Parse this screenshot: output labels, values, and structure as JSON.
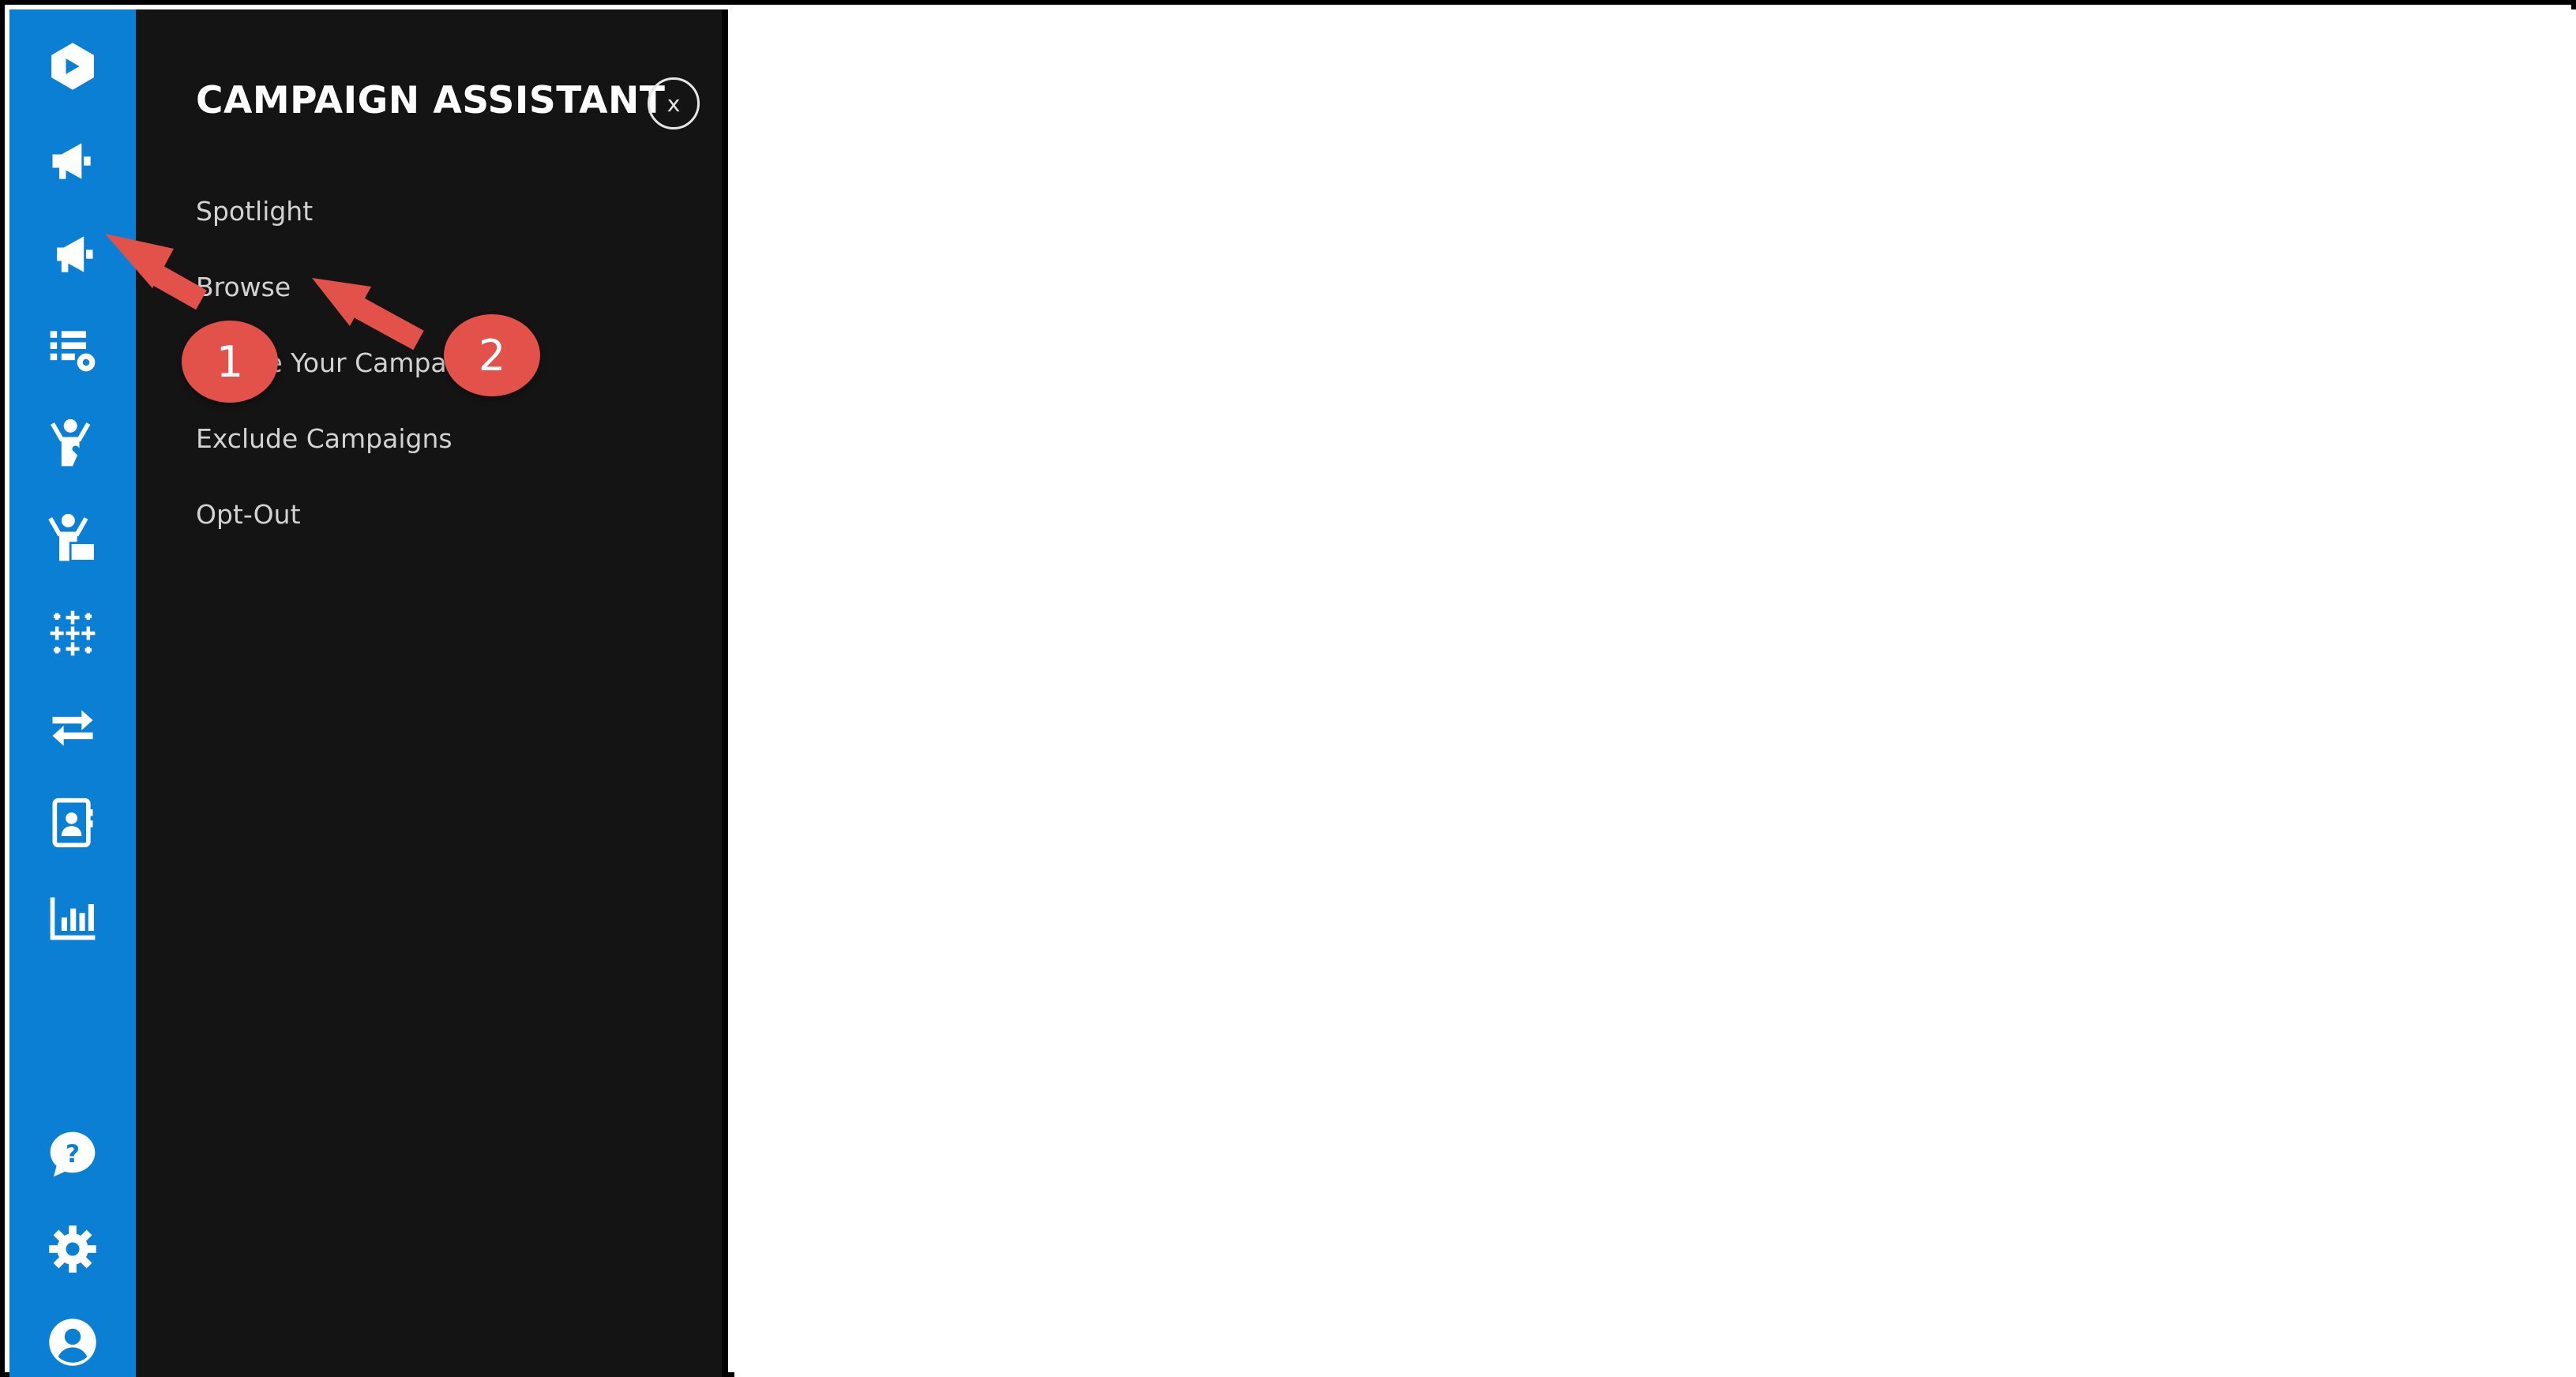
{
  "sidebar": {
    "icons": [
      {
        "name": "logo-icon"
      },
      {
        "name": "megaphone-icon"
      },
      {
        "name": "megaphone-add-icon"
      },
      {
        "name": "list-settings-icon"
      },
      {
        "name": "volunteer-heart-icon"
      },
      {
        "name": "volunteer-box-icon"
      },
      {
        "name": "sparkle-grid-icon"
      },
      {
        "name": "transfer-arrows-icon"
      },
      {
        "name": "contact-book-icon"
      },
      {
        "name": "bar-chart-icon"
      },
      {
        "name": "help-icon"
      },
      {
        "name": "gear-icon"
      },
      {
        "name": "user-avatar-icon"
      }
    ]
  },
  "panel": {
    "title": "CAMPAIGN ASSISTANT",
    "close_label": "x",
    "items": [
      {
        "label": "Spotlight"
      },
      {
        "label": "Browse"
      },
      {
        "label": "Create Your Campaign"
      },
      {
        "label": "Exclude Campaigns"
      },
      {
        "label": "Opt-Out"
      }
    ]
  },
  "annotations": {
    "step1": "1",
    "step2": "2"
  },
  "colors": {
    "rail": "#0a7fd4",
    "panel": "#141414",
    "annotation": "#e2514a"
  }
}
